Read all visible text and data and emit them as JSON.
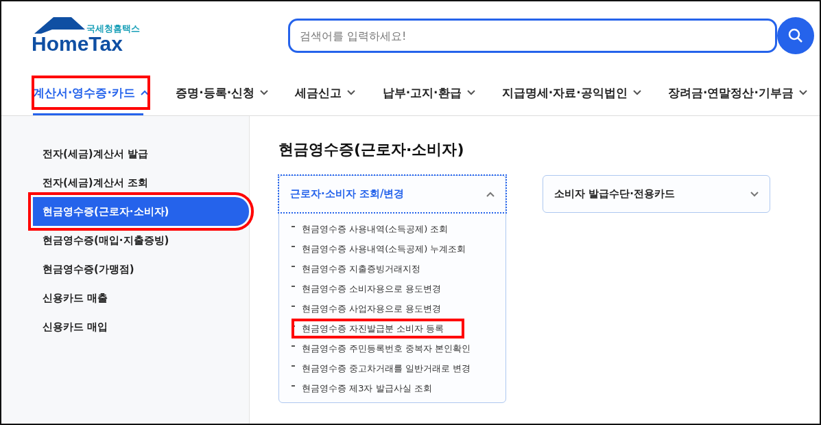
{
  "logo": {
    "subtitle": "국세청홈택스",
    "name": "HomeTax"
  },
  "search": {
    "placeholder": "검색어를 입력하세요!"
  },
  "nav": [
    {
      "label": "계산서·영수증·카드",
      "selected": true,
      "expanded": true,
      "highlighted": true
    },
    {
      "label": "증명·등록·신청",
      "selected": false,
      "expanded": false,
      "highlighted": false
    },
    {
      "label": "세금신고",
      "selected": false,
      "expanded": false,
      "highlighted": false
    },
    {
      "label": "납부·고지·환급",
      "selected": false,
      "expanded": false,
      "highlighted": false
    },
    {
      "label": "지급명세·자료·공익법인",
      "selected": false,
      "expanded": false,
      "highlighted": false
    },
    {
      "label": "장려금·연말정산·기부금",
      "selected": false,
      "expanded": false,
      "highlighted": false
    }
  ],
  "sidebar": {
    "items": [
      {
        "label": "전자(세금)계산서 발급",
        "selected": false,
        "highlighted": false
      },
      {
        "label": "전자(세금)계산서 조회",
        "selected": false,
        "highlighted": false
      },
      {
        "label": "현금영수증(근로자·소비자)",
        "selected": true,
        "highlighted": true
      },
      {
        "label": "현금영수증(매입·지출증빙)",
        "selected": false,
        "highlighted": false
      },
      {
        "label": "현금영수증(가맹점)",
        "selected": false,
        "highlighted": false
      },
      {
        "label": "신용카드 매출",
        "selected": false,
        "highlighted": false
      },
      {
        "label": "신용카드 매입",
        "selected": false,
        "highlighted": false
      }
    ]
  },
  "content": {
    "title": "현금영수증(근로자·소비자)",
    "sections": [
      {
        "title": "근로자·소비자 조회/변경",
        "expanded": true,
        "focused": true,
        "items": [
          {
            "label": "현금영수증 사용내역(소득공제) 조회",
            "highlighted": false
          },
          {
            "label": "현금영수증 사용내역(소득공제) 누계조회",
            "highlighted": false
          },
          {
            "label": "현금영수증 지출증빙거래지정",
            "highlighted": false
          },
          {
            "label": "현금영수증 소비자용으로 용도변경",
            "highlighted": false
          },
          {
            "label": "현금영수증 사업자용으로 용도변경",
            "highlighted": false
          },
          {
            "label": "현금영수증 자진발급분 소비자 등록",
            "highlighted": true
          },
          {
            "label": "현금영수증 주민등록번호 중복자 본인확인",
            "highlighted": false
          },
          {
            "label": "현금영수증 중고차거래를 일반거래로 변경",
            "highlighted": false
          },
          {
            "label": "현금영수증 제3자 발급사실 조회",
            "highlighted": false
          }
        ]
      },
      {
        "title": "소비자 발급수단·전용카드",
        "expanded": false,
        "focused": false
      }
    ]
  }
}
